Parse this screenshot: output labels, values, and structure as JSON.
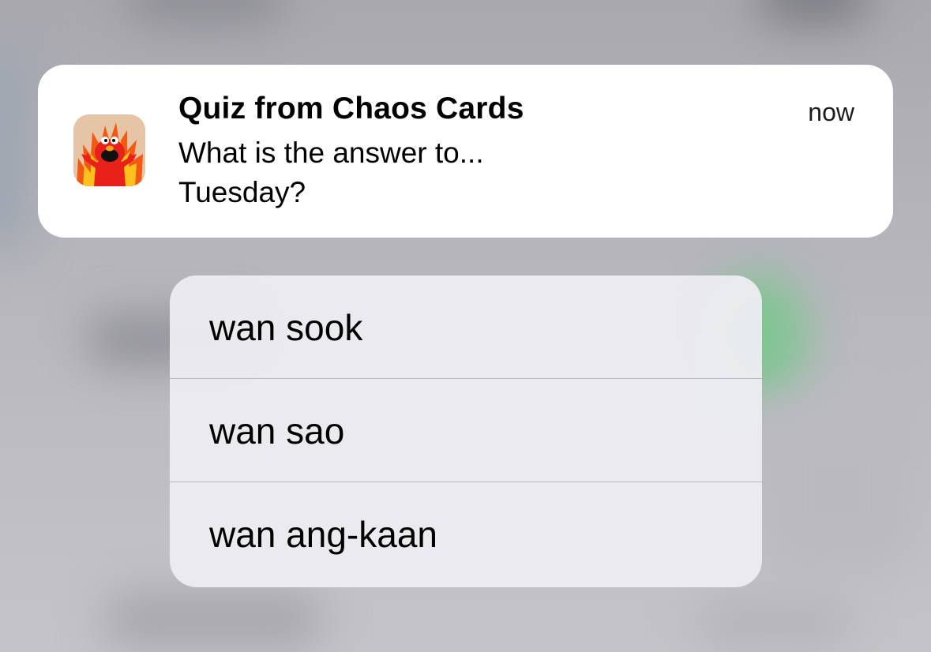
{
  "notification": {
    "app_icon": "chaos-cards-fire-creature-icon",
    "title": "Quiz from Chaos Cards",
    "time": "now",
    "body_line1": "What is the answer to...",
    "body_line2": "Tuesday?"
  },
  "actions": [
    {
      "label": "wan sook"
    },
    {
      "label": "wan sao"
    },
    {
      "label": "wan ang-kaan"
    }
  ]
}
